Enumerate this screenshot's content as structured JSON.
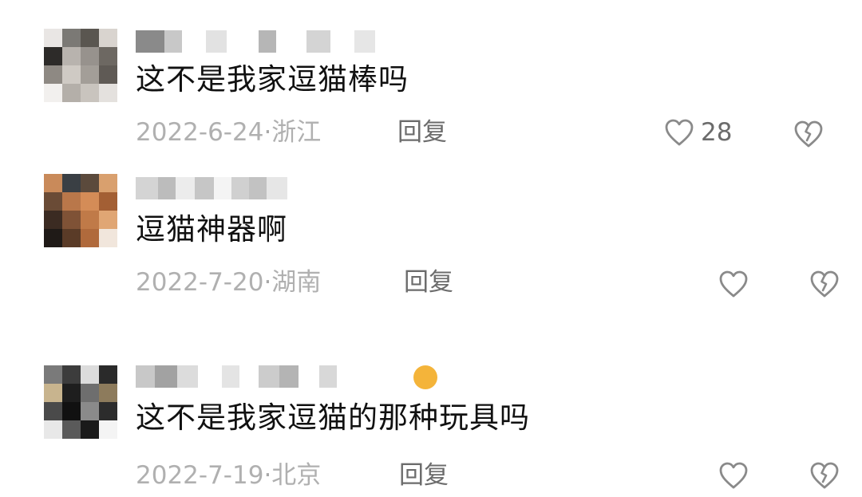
{
  "comments": [
    {
      "text": "这不是我家逗猫棒吗",
      "date": "2022-6-24",
      "separator": "·",
      "location": "浙江",
      "reply_label": "回复",
      "like_count": "28"
    },
    {
      "text": "逗猫神器啊",
      "date": "2022-7-20",
      "separator": "·",
      "location": "湖南",
      "reply_label": "回复",
      "like_count": ""
    },
    {
      "text": "这不是我家逗猫的那种玩具吗",
      "date": "2022-7-19",
      "separator": "·",
      "location": "北京",
      "reply_label": "回复",
      "like_count": ""
    }
  ],
  "icons": {
    "like": "heart-outline-icon",
    "dislike": "broken-heart-icon"
  },
  "colors": {
    "text": "#111111",
    "meta": "#b0b0b0",
    "reply": "#6c6c6c",
    "icon": "#8a8a8a"
  }
}
